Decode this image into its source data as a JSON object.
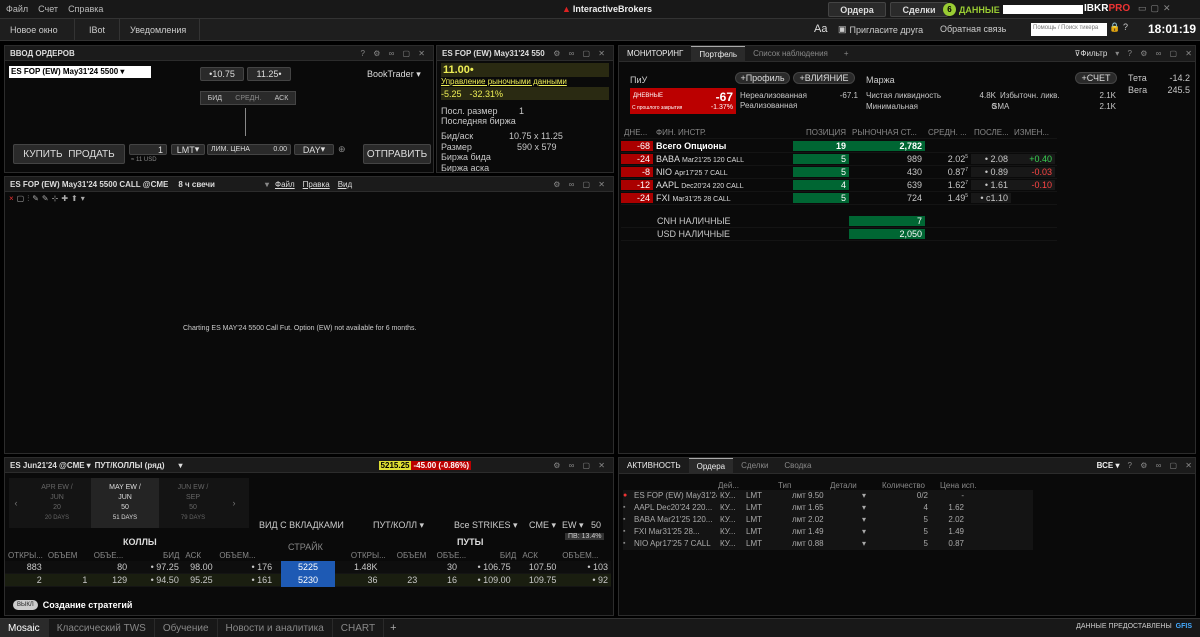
{
  "menubar": {
    "file": "Файл",
    "account": "Счет",
    "help": "Справка",
    "logo": "InteractiveBrokers",
    "orders_btn": "Ордера",
    "deals_btn": "Сделки",
    "notif_count": "6",
    "data_label": "ДАННЫЕ",
    "ibkr": "IBKR",
    "pro": "PRO"
  },
  "toolbar": {
    "new_window": "Новое окно",
    "ibot": "IBot",
    "notifications": "Уведомления",
    "font_icon": "Aa",
    "invite": "Пригласите друга",
    "feedback": "Обратная связь",
    "search_placeholder": "Помощь / Поиск тикера",
    "time": "18:01:19"
  },
  "order_entry": {
    "title": "ВВОД ОРДЕРОВ",
    "contract": "ES FOP (EW) May31'24 5500",
    "bid": "10.75",
    "ask": "11.25",
    "booktrader": "BookTrader",
    "bid_label": "БИД",
    "mid_label": "СРЕДН.",
    "ask_label": "АСК",
    "buy": "КУПИТЬ",
    "sell": "ПРОДАТЬ",
    "qty": "1",
    "qty_sub": "≈ 11 USD",
    "type": "LMT",
    "limit_label": "ЛИМ. ЦЕНА",
    "limit_val": "0.00",
    "tif": "DAY",
    "submit": "ОТПРАВИТЬ"
  },
  "quote": {
    "title": "ES FOP (EW) May31'24 550",
    "price": "11.00",
    "market_data": "Управление рыночными данными",
    "change": "-5.25",
    "change_pct": "-32.31%",
    "last_size_label": "Посл. размер",
    "last_size": "1",
    "last_exch_label": "Последняя биржа",
    "bidask_label": "Бид/аск",
    "bidask": "10.75 x 11.25",
    "size_label": "Размер",
    "size": "590 x 579",
    "bid_exch_label": "Биржа бида",
    "ask_exch_label": "Биржа аска"
  },
  "chart": {
    "title": "ES FOP (EW) May31'24 5500 CALL @CME",
    "period": "8 ч свечи",
    "file": "Файл",
    "edit": "Правка",
    "view": "Вид",
    "message": "Charting ES MAY'24 5500 Call Fut. Option (EW) not available for 6 months."
  },
  "monitor": {
    "tabs": [
      "МОНИТОРИНГ",
      "Портфель",
      "Список наблюдения"
    ],
    "filter": "Фильтр",
    "pnl_label": "ПиУ",
    "profile": "Профиль",
    "impact": "ВЛИЯНИЕ",
    "margin": "Маржа",
    "account": "СЧЕТ",
    "daily": "ДНЕВНЫЕ",
    "daily_val": "-67",
    "since_close": "С прошлого закрытия",
    "since_pct": "-1.37%",
    "unrealized_label": "Нереализованная",
    "unrealized": "-67.1",
    "realized_label": "Реализованная",
    "net_liq_label": "Чистая ликвидность",
    "net_liq": "4.8K",
    "excess_label": "Избыточн. ликв.",
    "excess": "2.1K",
    "min_label": "Минимальная",
    "min_val": "0",
    "sma": "SMA",
    "sma_val": "2.1K",
    "theta_label": "Тета",
    "theta": "-14.2",
    "vega_label": "Вега",
    "vega": "245.5",
    "cols": [
      "ДНЕ...",
      "ФИН. ИНСТР.",
      "ПОЗИЦИЯ",
      "РЫНОЧНАЯ СТ...",
      "СРЕДН. ...",
      "ПОСЛЕ...",
      "ИЗМЕН..."
    ],
    "total": {
      "day": "-68",
      "name": "Всего Опционы",
      "pos": "19",
      "mkt": "2,782"
    },
    "rows": [
      {
        "day": "-24",
        "sym": "BABA",
        "desc": "Mar21'25 120 CALL",
        "pos": "5",
        "mkt": "989",
        "avg": "2.02",
        "avgsup": "5",
        "last": "2.08",
        "chg": "+0.40",
        "chgc": "#39d353"
      },
      {
        "day": "-8",
        "sym": "NIO",
        "desc": "Apr17'25 7 CALL",
        "pos": "5",
        "mkt": "430",
        "avg": "0.87",
        "avgsup": "7",
        "last": "0.89",
        "chg": "-0.03",
        "chgc": "#ff4545"
      },
      {
        "day": "-12",
        "sym": "AAPL",
        "desc": "Dec20'24 220 CALL",
        "pos": "4",
        "mkt": "639",
        "avg": "1.62",
        "avgsup": "7",
        "last": "1.61",
        "chg": "-0.10",
        "chgc": "#ff4545"
      },
      {
        "day": "-24",
        "sym": "FXI",
        "desc": "Mar31'25 28 CALL",
        "pos": "5",
        "mkt": "724",
        "avg": "1.49",
        "avgsup": "5",
        "last": "c1.10",
        "chg": "",
        "chgc": "#ccc"
      }
    ],
    "cash": [
      {
        "label": "CNH НАЛИЧНЫЕ",
        "val": "7"
      },
      {
        "label": "USD НАЛИЧНЫЕ",
        "val": "2,050"
      }
    ]
  },
  "optchain": {
    "title": "ES Jun21'24 @CME",
    "mode": "ПУТ/КОЛЛЫ (ряд)",
    "price": "5215.25",
    "change": "-45.00 (-0.86%)",
    "exp": [
      {
        "a": "APR EW /",
        "b": "JUN",
        "c": "20",
        "d": "20 DAYS"
      },
      {
        "a": "MAY EW /",
        "b": "JUN",
        "c": "50",
        "d": "51 DAYS"
      },
      {
        "a": "JUN EW /",
        "b": "SEP",
        "c": "50",
        "d": "79 DAYS"
      }
    ],
    "view_tabs": "ВИД С ВКЛАДКАМИ",
    "putcall": "ПУТ/КОЛЛ",
    "strikes": "Все STRIKES",
    "exch": "CME",
    "ew": "EW",
    "num": "50",
    "pv": "ПВ: 13.4%",
    "calls": "КОЛЛЫ",
    "puts": "ПУТЫ",
    "strike": "СТРАЙК",
    "cols_l": [
      "ОТКРЫ...",
      "ОБЪЕМ",
      "ОБЪЕ...",
      "БИД",
      "АСК",
      "ОБЪЕМ..."
    ],
    "cols_r": [
      "ОТКРЫ...",
      "ОБЪЕМ",
      "ОБЪЕ...",
      "БИД",
      "АСК",
      "ОБЪЕМ..."
    ],
    "rows": [
      {
        "oi": "883",
        "vol": "",
        "bsz": "80",
        "bid": "97.25",
        "ask": "98.00",
        "asz": "176",
        "strike": "5225",
        "poi": "1.48K",
        "pvol": "",
        "pbsz": "30",
        "pbid": "106.75",
        "pask": "107.50",
        "pasz": "103"
      },
      {
        "oi": "2",
        "vol": "1",
        "bsz": "129",
        "bid": "94.50",
        "ask": "95.25",
        "asz": "161",
        "strike": "5230",
        "poi": "36",
        "pvol": "23",
        "pbsz": "16",
        "pbid": "109.00",
        "pask": "109.75",
        "pasz": "92"
      }
    ],
    "toggle": "ВЫКЛ",
    "strategy": "Создание стратегий"
  },
  "activity": {
    "tabs": [
      "АКТИВНОСТЬ",
      "Ордера",
      "Сделки",
      "Сводка"
    ],
    "all": "ВСЕ",
    "cols": [
      "Дей...",
      "Тип",
      "Детали",
      "Количество",
      "Цена исп."
    ],
    "rows": [
      {
        "sym": "ES FOP (EW) May31'24...",
        "act": "КУ...",
        "type": "LMT",
        "det": "лмт 9.50",
        "qty": "0/2",
        "price": "-"
      },
      {
        "sym": "AAPL Dec20'24 220...",
        "act": "КУ...",
        "type": "LMT",
        "det": "лмт 1.65",
        "qty": "4",
        "price": "1.62"
      },
      {
        "sym": "BABA Mar21'25 120...",
        "act": "КУ...",
        "type": "LMT",
        "det": "лмт 2.02",
        "qty": "5",
        "price": "2.02"
      },
      {
        "sym": "FXI Mar31'25 28...",
        "act": "КУ...",
        "type": "LMT",
        "det": "лмт 1.49",
        "qty": "5",
        "price": "1.49"
      },
      {
        "sym": "NIO Apr17'25 7 CALL",
        "act": "КУ...",
        "type": "LMT",
        "det": "лмт 0.88",
        "qty": "5",
        "price": "0.87"
      }
    ]
  },
  "statusbar": {
    "tabs": [
      "Mosaic",
      "Классический TWS",
      "Обучение",
      "Новости и аналитика",
      "CHART"
    ],
    "provided": "ДАННЫЕ ПРЕДОСТАВЛЕНЫ",
    "gfis": "GFIS"
  }
}
